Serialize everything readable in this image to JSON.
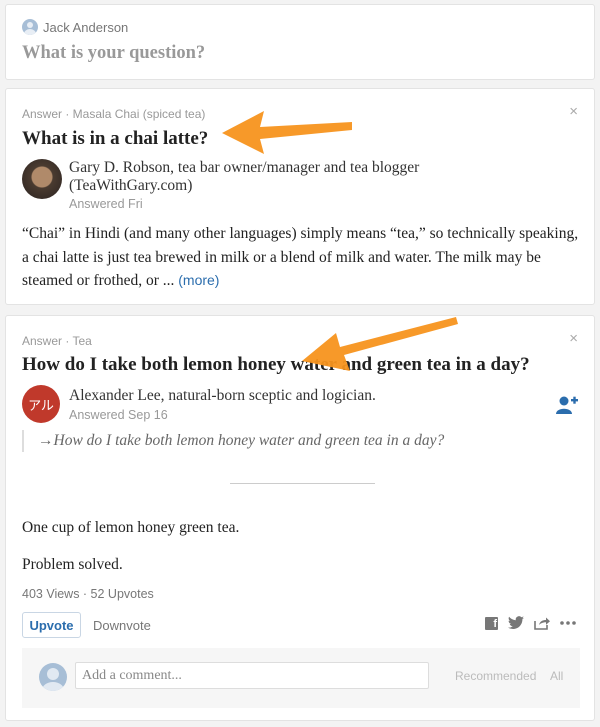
{
  "ask_box": {
    "user_name": "Jack Anderson",
    "prompt": "What is your question?"
  },
  "answers": [
    {
      "topic_line": "Answer · Masala Chai (spiced tea)",
      "question": "What is in a chai latte?",
      "author_credential": "Gary D. Robson, tea bar owner/manager and tea blogger (TeaWithGary.com)",
      "answered": "Answered Fri",
      "body": "“Chai” in Hindi (and many other languages) simply means “tea,” so technically speaking, a chai latte is just tea brewed in milk or a blend of milk and water. The milk may be steamed or frothed, or ...",
      "more_label": "(more)",
      "close_label": "×"
    },
    {
      "topic_line": "Answer · Tea",
      "question": "How do I take both lemon honey water and green tea in a day?",
      "avatar_text": "アル",
      "author_credential": "Alexander Lee, natural-born sceptic and logician.",
      "answered": "Answered Sep 16",
      "quote": "→How do I take both lemon honey water and green tea in a day?",
      "paragraphs": [
        "One cup of lemon honey green tea.",
        "Problem solved."
      ],
      "stats": "403 Views · 52 Upvotes",
      "upvote_label": "Upvote",
      "downvote_label": "Downvote",
      "comment_placeholder": "Add a comment...",
      "sort_recommended": "Recommended",
      "sort_all": "All",
      "close_label": "×",
      "fb_glyph": "f"
    }
  ],
  "icons": [
    "user-avatar-icon",
    "close-icon",
    "follow-user-icon",
    "facebook-icon",
    "twitter-icon",
    "share-icon",
    "more-options-icon",
    "annotation-arrow"
  ],
  "colors": {
    "accent": "#2b6dad",
    "arrow": "#f7941d",
    "red_avatar": "#c0392b"
  }
}
